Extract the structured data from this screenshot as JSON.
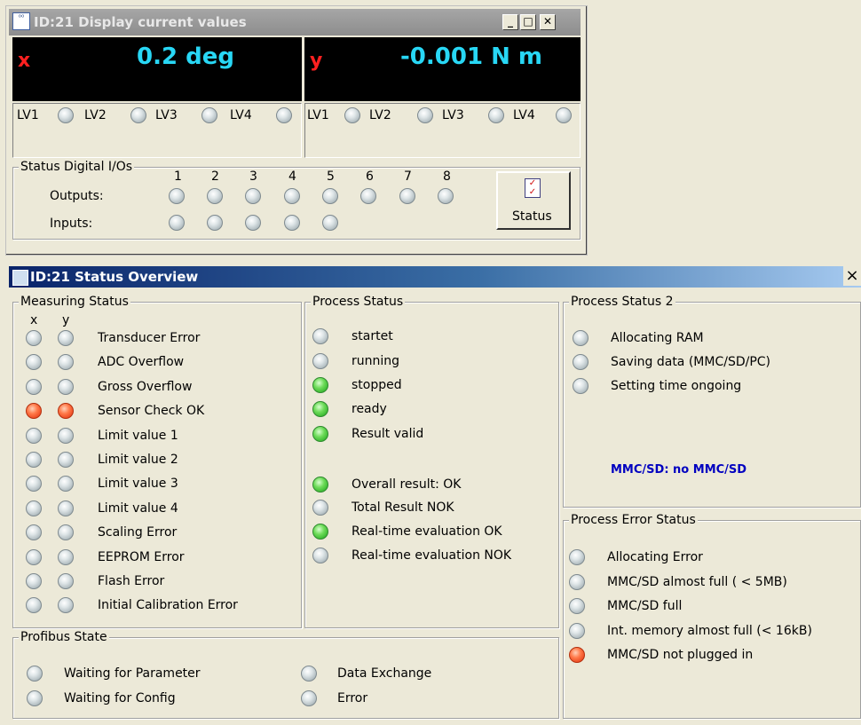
{
  "win1": {
    "title": "ID:21   Display current values",
    "x": {
      "letter": "x",
      "value": "0.2  deg"
    },
    "y": {
      "letter": "y",
      "value": "-0.001  N m"
    },
    "lv": [
      "LV1",
      "LV2",
      "LV3",
      "LV4"
    ],
    "dio": {
      "legend": "Status Digital I/Os",
      "numbers": [
        "1",
        "2",
        "3",
        "4",
        "5",
        "6",
        "7",
        "8"
      ],
      "outputs_label": "Outputs:",
      "inputs_label": "Inputs:",
      "status_button": "Status"
    }
  },
  "win2": {
    "title": "ID:21   Status Overview",
    "close": "×",
    "measuring": {
      "legend": "Measuring Status",
      "col_x": "x",
      "col_y": "y",
      "items": [
        {
          "label": "Transducer Error",
          "state": "off"
        },
        {
          "label": "ADC Overflow",
          "state": "off"
        },
        {
          "label": "Gross Overflow",
          "state": "off"
        },
        {
          "label": "Sensor Check OK",
          "state": "red"
        },
        {
          "label": "Limit value 1",
          "state": "off"
        },
        {
          "label": "Limit value 2",
          "state": "off"
        },
        {
          "label": "Limit value 3",
          "state": "off"
        },
        {
          "label": "Limit value 4",
          "state": "off"
        },
        {
          "label": "Scaling Error",
          "state": "off"
        },
        {
          "label": "EEPROM Error",
          "state": "off"
        },
        {
          "label": "Flash Error",
          "state": "off"
        },
        {
          "label": "Initial Calibration Error",
          "state": "off"
        }
      ]
    },
    "process": {
      "legend": "Process Status",
      "items": [
        {
          "label": "startet",
          "state": "off"
        },
        {
          "label": "running",
          "state": "off"
        },
        {
          "label": "stopped",
          "state": "green"
        },
        {
          "label": "ready",
          "state": "green"
        },
        {
          "label": "Result valid",
          "state": "green"
        },
        {
          "label": "Overall result: OK",
          "state": "green"
        },
        {
          "label": "Total Result NOK",
          "state": "off"
        },
        {
          "label": "Real-time evaluation OK",
          "state": "green"
        },
        {
          "label": "Real-time evaluation NOK",
          "state": "off"
        }
      ]
    },
    "process2": {
      "legend": "Process Status 2",
      "items": [
        {
          "label": "Allocating RAM",
          "state": "off"
        },
        {
          "label": "Saving data (MMC/SD/PC)",
          "state": "off"
        },
        {
          "label": "Setting time ongoing",
          "state": "off"
        }
      ],
      "mmc_text": "MMC/SD: no MMC/SD"
    },
    "error": {
      "legend": "Process Error Status",
      "items": [
        {
          "label": "Allocating Error",
          "state": "off"
        },
        {
          "label": "MMC/SD almost full ( < 5MB)",
          "state": "off"
        },
        {
          "label": "MMC/SD full",
          "state": "off"
        },
        {
          "label": "Int. memory almost full (< 16kB)",
          "state": "off"
        },
        {
          "label": "MMC/SD not plugged in",
          "state": "red"
        }
      ]
    },
    "profibus": {
      "legend": "Profibus State",
      "left": [
        {
          "label": "Waiting for Parameter",
          "state": "off"
        },
        {
          "label": "Waiting for Config",
          "state": "off"
        }
      ],
      "right": [
        {
          "label": "Data Exchange",
          "state": "off"
        },
        {
          "label": "Error",
          "state": "off"
        }
      ]
    }
  }
}
